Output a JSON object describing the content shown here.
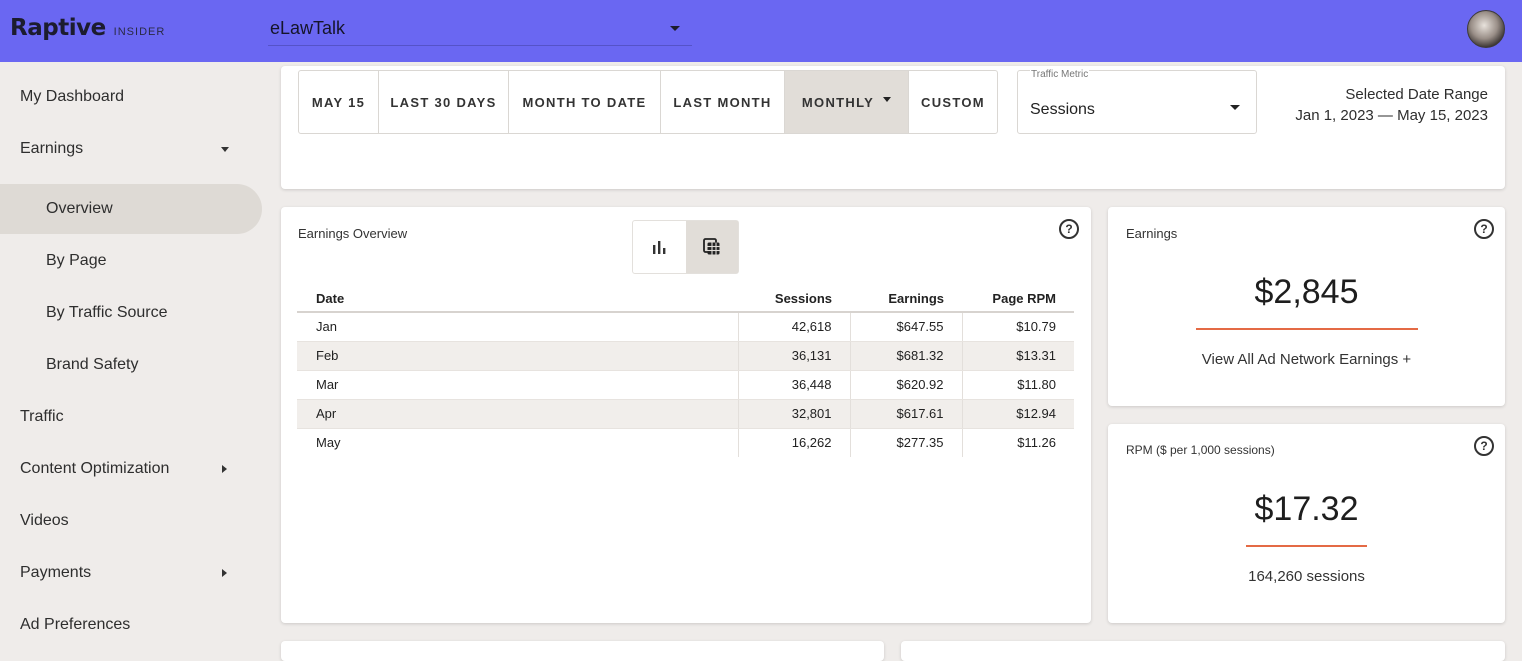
{
  "header": {
    "brand": "Raptive",
    "brand_sub": "INSIDER",
    "site": "eLawTalk"
  },
  "sidebar": {
    "items": [
      {
        "label": "My Dashboard"
      },
      {
        "label": "Earnings"
      },
      {
        "label": "Overview"
      },
      {
        "label": "By Page"
      },
      {
        "label": "By Traffic Source"
      },
      {
        "label": "Brand Safety"
      },
      {
        "label": "Traffic"
      },
      {
        "label": "Content Optimization"
      },
      {
        "label": "Videos"
      },
      {
        "label": "Payments"
      },
      {
        "label": "Ad Preferences"
      }
    ]
  },
  "filters": {
    "ranges": [
      "MAY 15",
      "LAST 30 DAYS",
      "MONTH TO DATE",
      "LAST MONTH",
      "MONTHLY",
      "CUSTOM"
    ],
    "selected_range": "MONTHLY",
    "metric_label": "Traffic Metric",
    "metric_value": "Sessions",
    "date_range_label": "Selected Date Range",
    "date_range_value": "Jan 1, 2023 — May 15, 2023"
  },
  "overview": {
    "title": "Earnings Overview",
    "columns": [
      "Date",
      "Sessions",
      "Earnings",
      "Page RPM"
    ],
    "rows": [
      [
        "Jan",
        "42,618",
        "$647.55",
        "$10.79"
      ],
      [
        "Feb",
        "36,131",
        "$681.32",
        "$13.31"
      ],
      [
        "Mar",
        "36,448",
        "$620.92",
        "$11.80"
      ],
      [
        "Apr",
        "32,801",
        "$617.61",
        "$12.94"
      ],
      [
        "May",
        "16,262",
        "$277.35",
        "$11.26"
      ]
    ]
  },
  "earnings_card": {
    "title": "Earnings",
    "value": "$2,845",
    "link": "View All Ad Network Earnings +"
  },
  "rpm_card": {
    "title": "RPM ($ per 1,000 sessions)",
    "value": "$17.32",
    "sessions": "164,260 sessions"
  },
  "help_symbol": "?",
  "colors": {
    "topbar": "#6a67f2",
    "accent": "#e46a45",
    "active_nav": "#dedad5"
  },
  "icons": [
    "bar-chart-icon",
    "table-icon",
    "help-icon",
    "dropdown-caret-icon"
  ]
}
